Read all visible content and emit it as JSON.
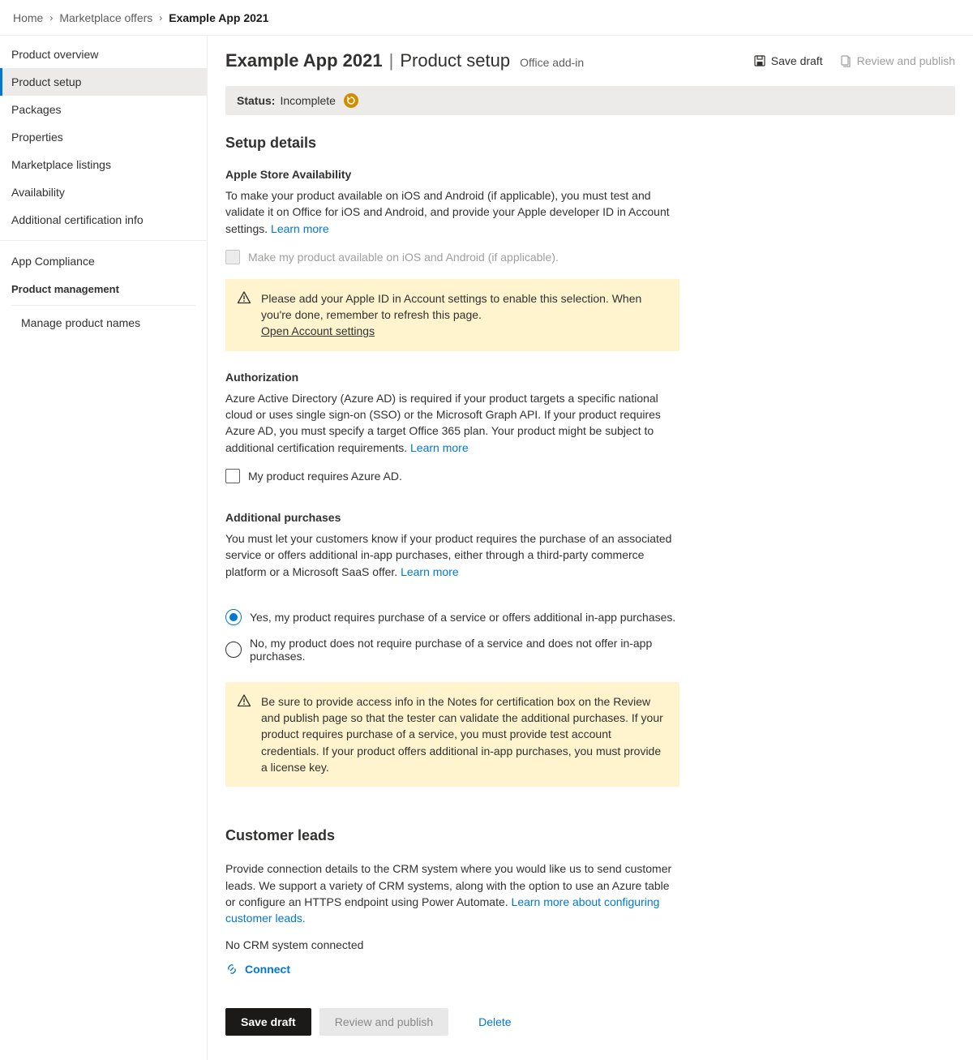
{
  "breadcrumb": {
    "home": "Home",
    "offers": "Marketplace offers",
    "current": "Example App 2021"
  },
  "sidebar": {
    "items": [
      "Product overview",
      "Product setup",
      "Packages",
      "Properties",
      "Marketplace listings",
      "Availability",
      "Additional certification info"
    ],
    "compliance": "App Compliance",
    "pm_heading": "Product management",
    "manage_names": "Manage product names"
  },
  "header": {
    "title": "Example App 2021",
    "subtitle": "Product setup",
    "tag": "Office add-in",
    "save_draft": "Save draft",
    "review_publish": "Review and publish"
  },
  "status": {
    "label": "Status:",
    "value": "Incomplete"
  },
  "setup": {
    "heading": "Setup details",
    "apple": {
      "heading": "Apple Store Availability",
      "body": "To make your product available on iOS and Android (if applicable), you must test and validate it on Office for iOS and Android, and provide your Apple developer ID in Account settings. ",
      "learn": "Learn more",
      "checkbox": "Make my product available on iOS and Android (if applicable).",
      "notice": "Please add your Apple ID in Account settings to enable this selection. When you're done, remember to refresh this page.",
      "notice_link": "Open Account settings"
    },
    "auth": {
      "heading": "Authorization",
      "body": "Azure Active Directory (Azure AD) is required if your product targets a specific national cloud or uses single sign-on (SSO) or the Microsoft Graph API. If your product requires Azure AD, you must specify a target Office 365 plan. Your product might be subject to additional certification requirements. ",
      "learn": "Learn more",
      "checkbox": "My product requires Azure AD."
    },
    "purchases": {
      "heading": "Additional purchases",
      "body": "You must let your customers know if your product requires the purchase of an associated service or offers additional in-app purchases, either through a third-party commerce platform or a Microsoft SaaS offer. ",
      "learn": "Learn more",
      "opt_yes": "Yes, my product requires purchase of a service or offers additional in-app purchases.",
      "opt_no": "No, my product does not require purchase of a service and does not offer in-app purchases.",
      "notice": "Be sure to provide access info in the Notes for certification box on the Review and publish page so that the tester can validate the additional purchases. If your product requires purchase of a service, you must provide test account credentials.  If your product offers additional in-app purchases, you must provide a license key."
    }
  },
  "leads": {
    "heading": "Customer leads",
    "body": "Provide connection details to the CRM system where you would like us to send customer leads. We support a variety of CRM systems, along with the option to use an Azure table or configure an HTTPS endpoint using Power Automate. ",
    "learn": "Learn more about configuring customer leads.",
    "status": "No CRM system connected",
    "connect": "Connect"
  },
  "footer": {
    "save": "Save draft",
    "review": "Review and publish",
    "delete": "Delete"
  }
}
